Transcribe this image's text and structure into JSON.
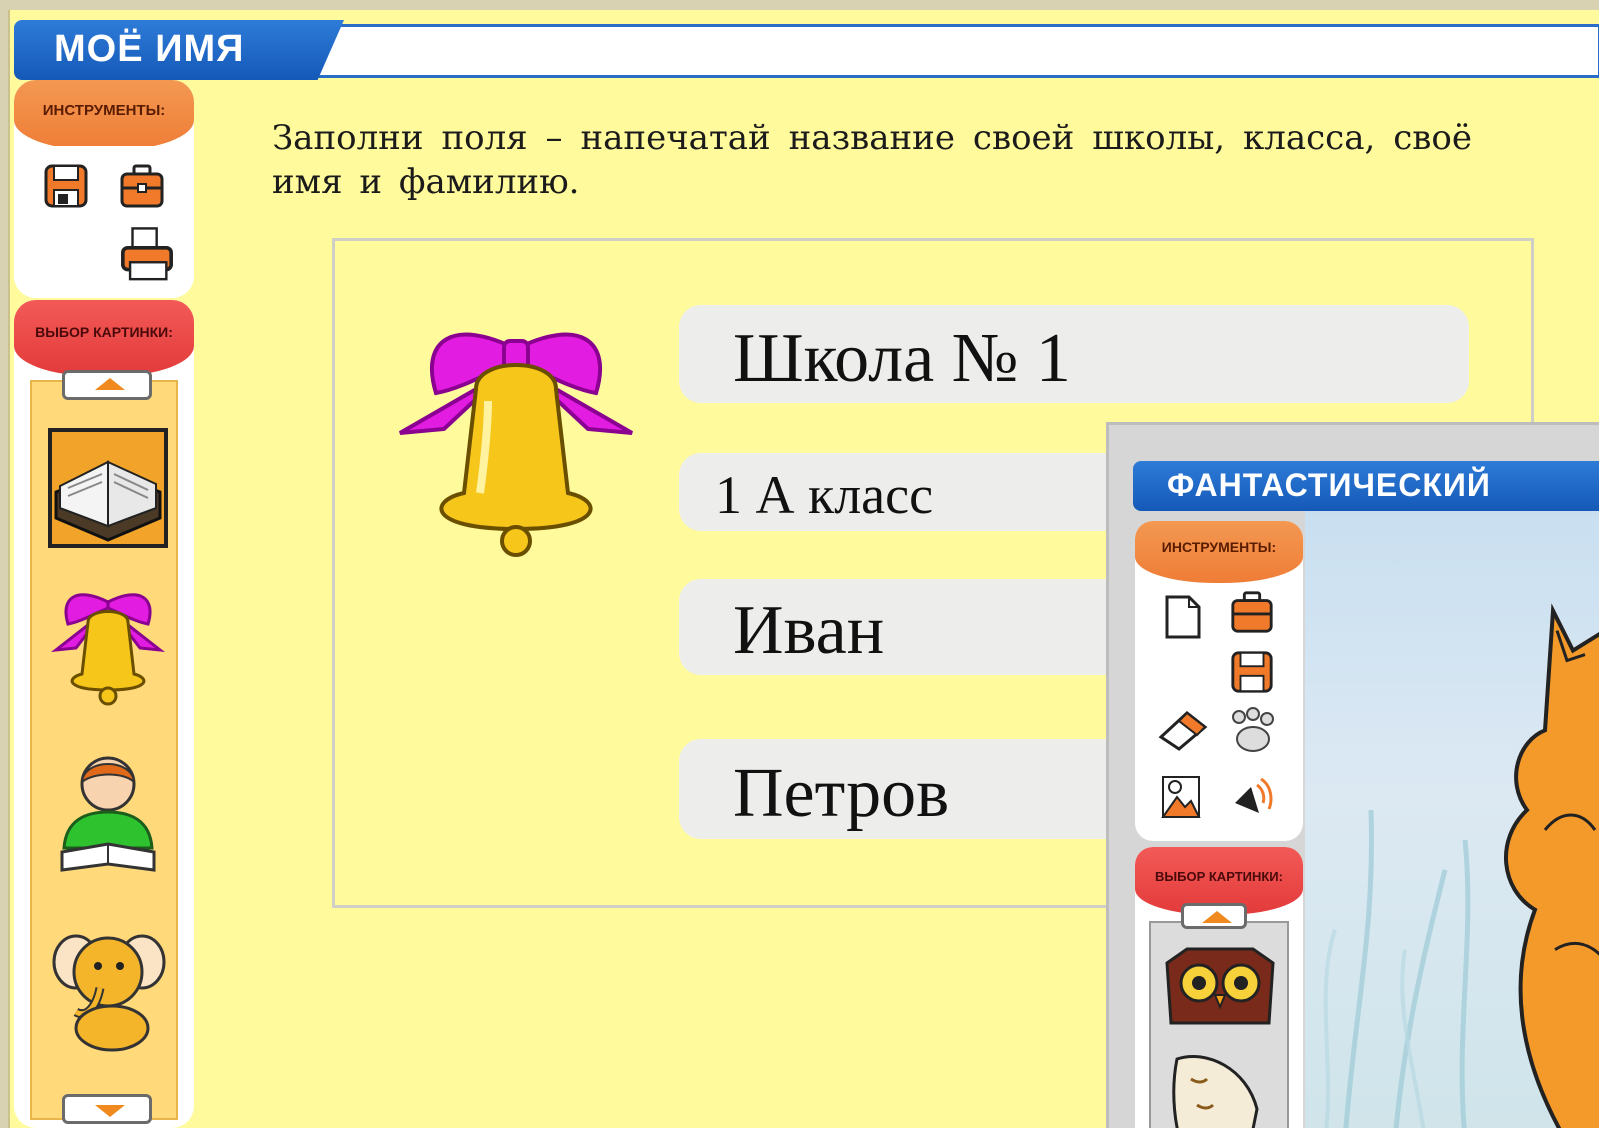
{
  "window": {
    "title": "МОЁ ИМЯ"
  },
  "tools_panel": {
    "header": "ИНСТРУМЕНТЫ:",
    "tools": [
      "save-icon",
      "briefcase-icon",
      "printer-icon"
    ]
  },
  "picture_panel": {
    "header": "ВЫБОР КАРТИНКИ:",
    "thumbnails": [
      "book-icon",
      "bell-icon",
      "reading-boy-icon",
      "elephant-icon"
    ]
  },
  "instruction": "Заполни поля – напечатай название своей школы, класса, своё имя и фамилию.",
  "form": {
    "school": "Школа № 1",
    "class": "1 А класс",
    "first_name": "Иван",
    "last_name": "Петров"
  },
  "overlay": {
    "title": "ФАНТАСТИЧЕСКИЙ",
    "tools_header": "ИНСТРУМЕНТЫ:",
    "tools": [
      "new-page-icon",
      "briefcase-icon",
      "save-icon",
      "eraser-icon",
      "paw-icon",
      "picture-icon",
      "sound-icon"
    ],
    "pictures_header": "ВЫБОР КАРТИНКИ:",
    "thumbnails": [
      "owl-icon",
      "owl-feather-icon"
    ]
  },
  "colors": {
    "background": "#fffa9c",
    "title_blue": "#1e66c8",
    "tools_orange": "#f08a44",
    "pictures_red": "#e94444",
    "field_gray": "#ededeb"
  }
}
